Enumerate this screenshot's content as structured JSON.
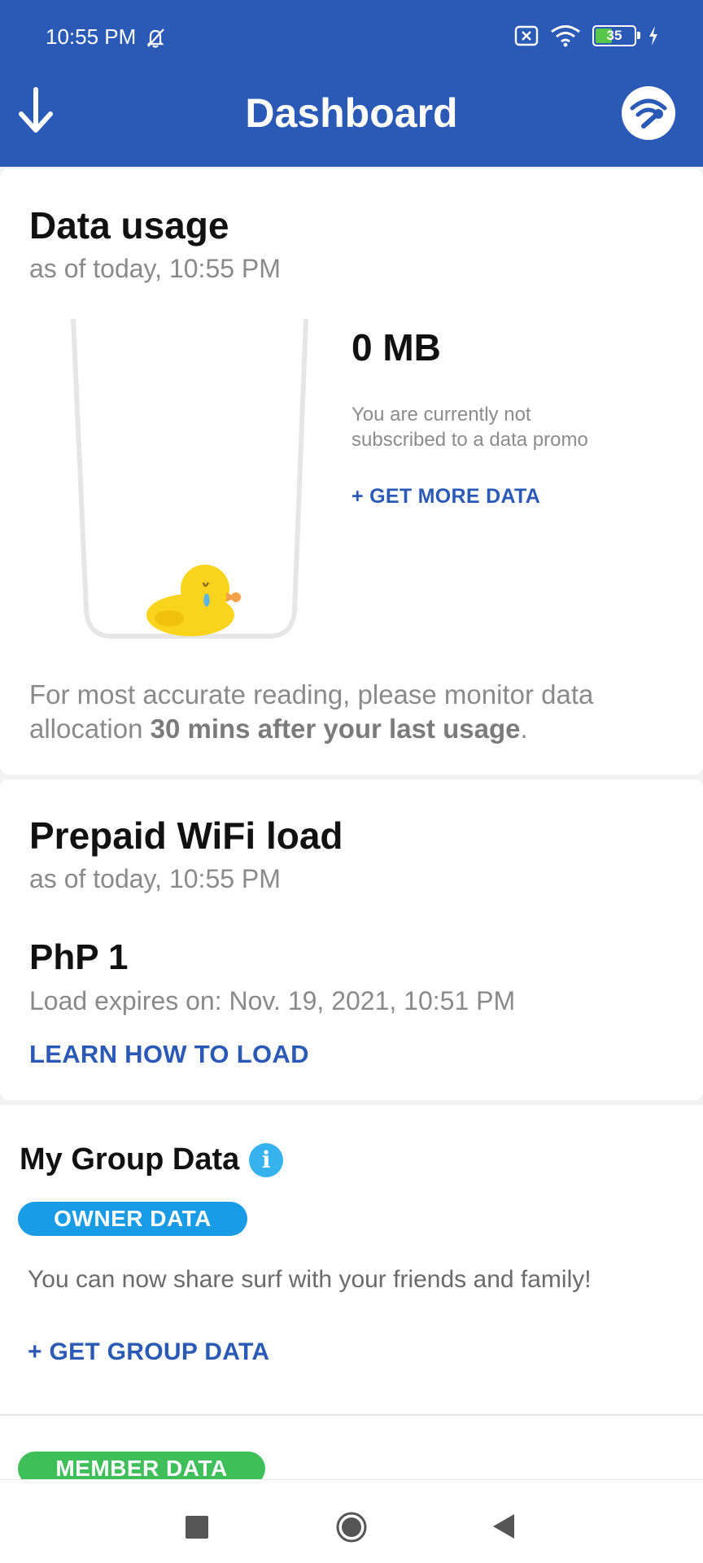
{
  "status_bar": {
    "time": "10:55 PM",
    "battery": "35",
    "icons": [
      "bell-off-icon",
      "sim-off-icon",
      "wifi-icon",
      "battery-icon",
      "charging-icon"
    ]
  },
  "header": {
    "title": "Dashboard",
    "back_icon": "arrow-down-icon",
    "right_icon": "wifi-wrench-icon",
    "color": "#2a5ab5"
  },
  "data_usage": {
    "title": "Data usage",
    "as_of": "as of today, 10:55 PM",
    "amount": "0 MB",
    "note": "You are currently not subscribed to a data promo",
    "get_more": "+ GET MORE DATA",
    "accuracy_prefix": "For most accurate reading, please monitor data allocation ",
    "accuracy_bold": "30 mins after your last usage",
    "accuracy_suffix": "."
  },
  "wifi_load": {
    "title": "Prepaid WiFi load",
    "as_of": "as of today, 10:55 PM",
    "amount": "PhP 1",
    "expires": "Load expires on: Nov. 19, 2021, 10:51 PM",
    "learn": "LEARN HOW TO LOAD"
  },
  "group_data": {
    "title": "My Group Data",
    "owner_pill": "OWNER DATA",
    "share_text": "You can now share surf with your friends and family!",
    "get_group": "+ GET GROUP DATA",
    "member_pill": "MEMBER DATA"
  },
  "colors": {
    "accent": "#2a5ab5",
    "owner": "#1a9be6",
    "member": "#3fbf5a",
    "info": "#36b2ef"
  }
}
